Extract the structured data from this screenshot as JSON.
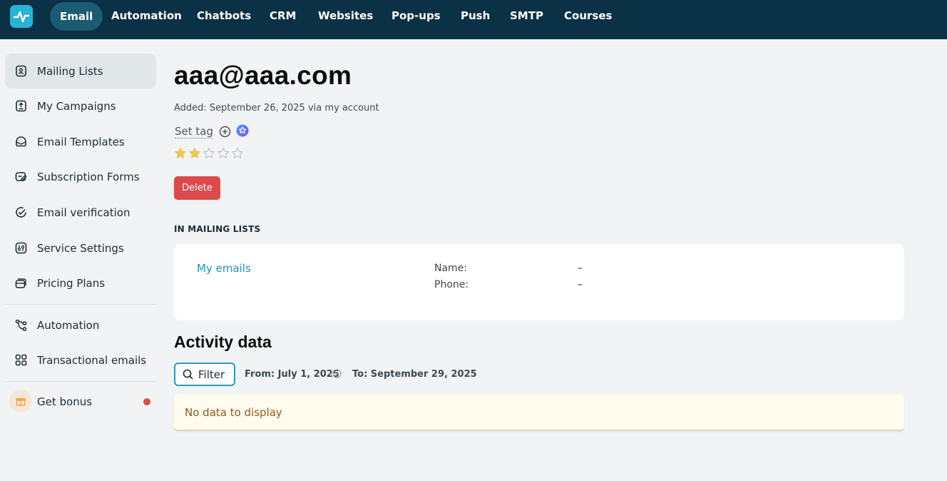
{
  "brand": {
    "logo_icon": "pulse-logo-icon",
    "accent": "#27b3d6"
  },
  "nav": {
    "items": [
      {
        "label": "Email",
        "active": true
      },
      {
        "label": "Automation"
      },
      {
        "label": "Chatbots"
      },
      {
        "label": "CRM"
      },
      {
        "label": "Websites"
      },
      {
        "label": "Pop-ups"
      },
      {
        "label": "Push"
      },
      {
        "label": "SMTP"
      },
      {
        "label": "Courses"
      }
    ]
  },
  "sidebar": {
    "items": [
      {
        "label": "Mailing Lists",
        "icon": "contacts-book-icon",
        "active": true
      },
      {
        "label": "My Campaigns",
        "icon": "campaign-upload-icon"
      },
      {
        "label": "Email Templates",
        "icon": "template-icon"
      },
      {
        "label": "Subscription Forms",
        "icon": "form-edit-icon"
      },
      {
        "label": "Email verification",
        "icon": "check-circle-icon"
      },
      {
        "label": "Service Settings",
        "icon": "sliders-icon"
      },
      {
        "label": "Pricing Plans",
        "icon": "cards-icon"
      },
      {
        "label": "Automation",
        "icon": "workflow-icon"
      },
      {
        "label": "Transactional emails",
        "icon": "grid-icon"
      },
      {
        "label": "Get bonus",
        "icon": "gift-icon"
      }
    ]
  },
  "contact": {
    "email": "aaa@aaa.com",
    "added": "Added: September 26, 2025 via my account",
    "set_tag": "Set tag",
    "rating": 2,
    "rating_max": 5,
    "delete_label": "Delete"
  },
  "mailing_lists": {
    "heading": "IN MAILING LISTS",
    "list_name": "My emails",
    "fields": [
      {
        "label": "Name:",
        "value": "–"
      },
      {
        "label": "Phone:",
        "value": "–"
      }
    ]
  },
  "activity": {
    "heading": "Activity data",
    "filter_label": "Filter",
    "from": "From: July 1, 2025",
    "to": "To: September 29, 2025",
    "empty": "No data to display"
  },
  "colors": {
    "topbar": "#0b3147",
    "delete": "#dc4a4c",
    "link": "#1f95b5",
    "star_filled": "#f0c94a"
  }
}
